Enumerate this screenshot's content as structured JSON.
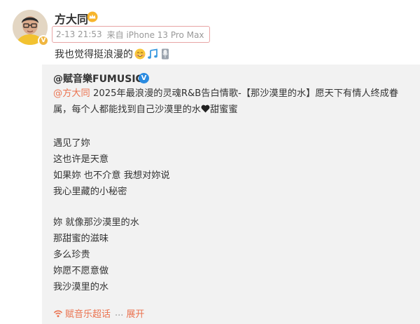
{
  "post": {
    "author": "方大同",
    "meta": {
      "time": "2-13 21:53",
      "source": "来自 iPhone 13 Pro Max"
    },
    "text": "我也觉得挺浪漫的",
    "emojis": [
      "smile-emoji",
      "music-note-emoji",
      "microphone-emoji"
    ]
  },
  "repost": {
    "author": "@赋音樂FUMUSIC",
    "intro_mention": "@方大同",
    "intro_text": " 2025年最浪漫的灵魂R&B告白情歌-【那沙漠里的水】愿天下有情人终成眷属，每个人都能找到自己沙漠里的水",
    "intro_tail": "甜蜜蜜",
    "lyrics": [
      "遇见了妳",
      "这也许是天意",
      "如果妳  也不介意   我想对妳说",
      "我心里藏的小秘密",
      "妳  就像那沙漠里的水",
      "那甜蜜的滋味",
      "多么珍贵",
      "妳愿不愿意做",
      "我沙漠里的水"
    ],
    "topic": "赋音乐超话",
    "ellipsis": "...",
    "expand": "展开"
  },
  "colors": {
    "link": "#eb7350",
    "verified_blue": "#2b8be0",
    "verified_gold": "#f0b640",
    "highlight_border": "#e8a5a5"
  }
}
